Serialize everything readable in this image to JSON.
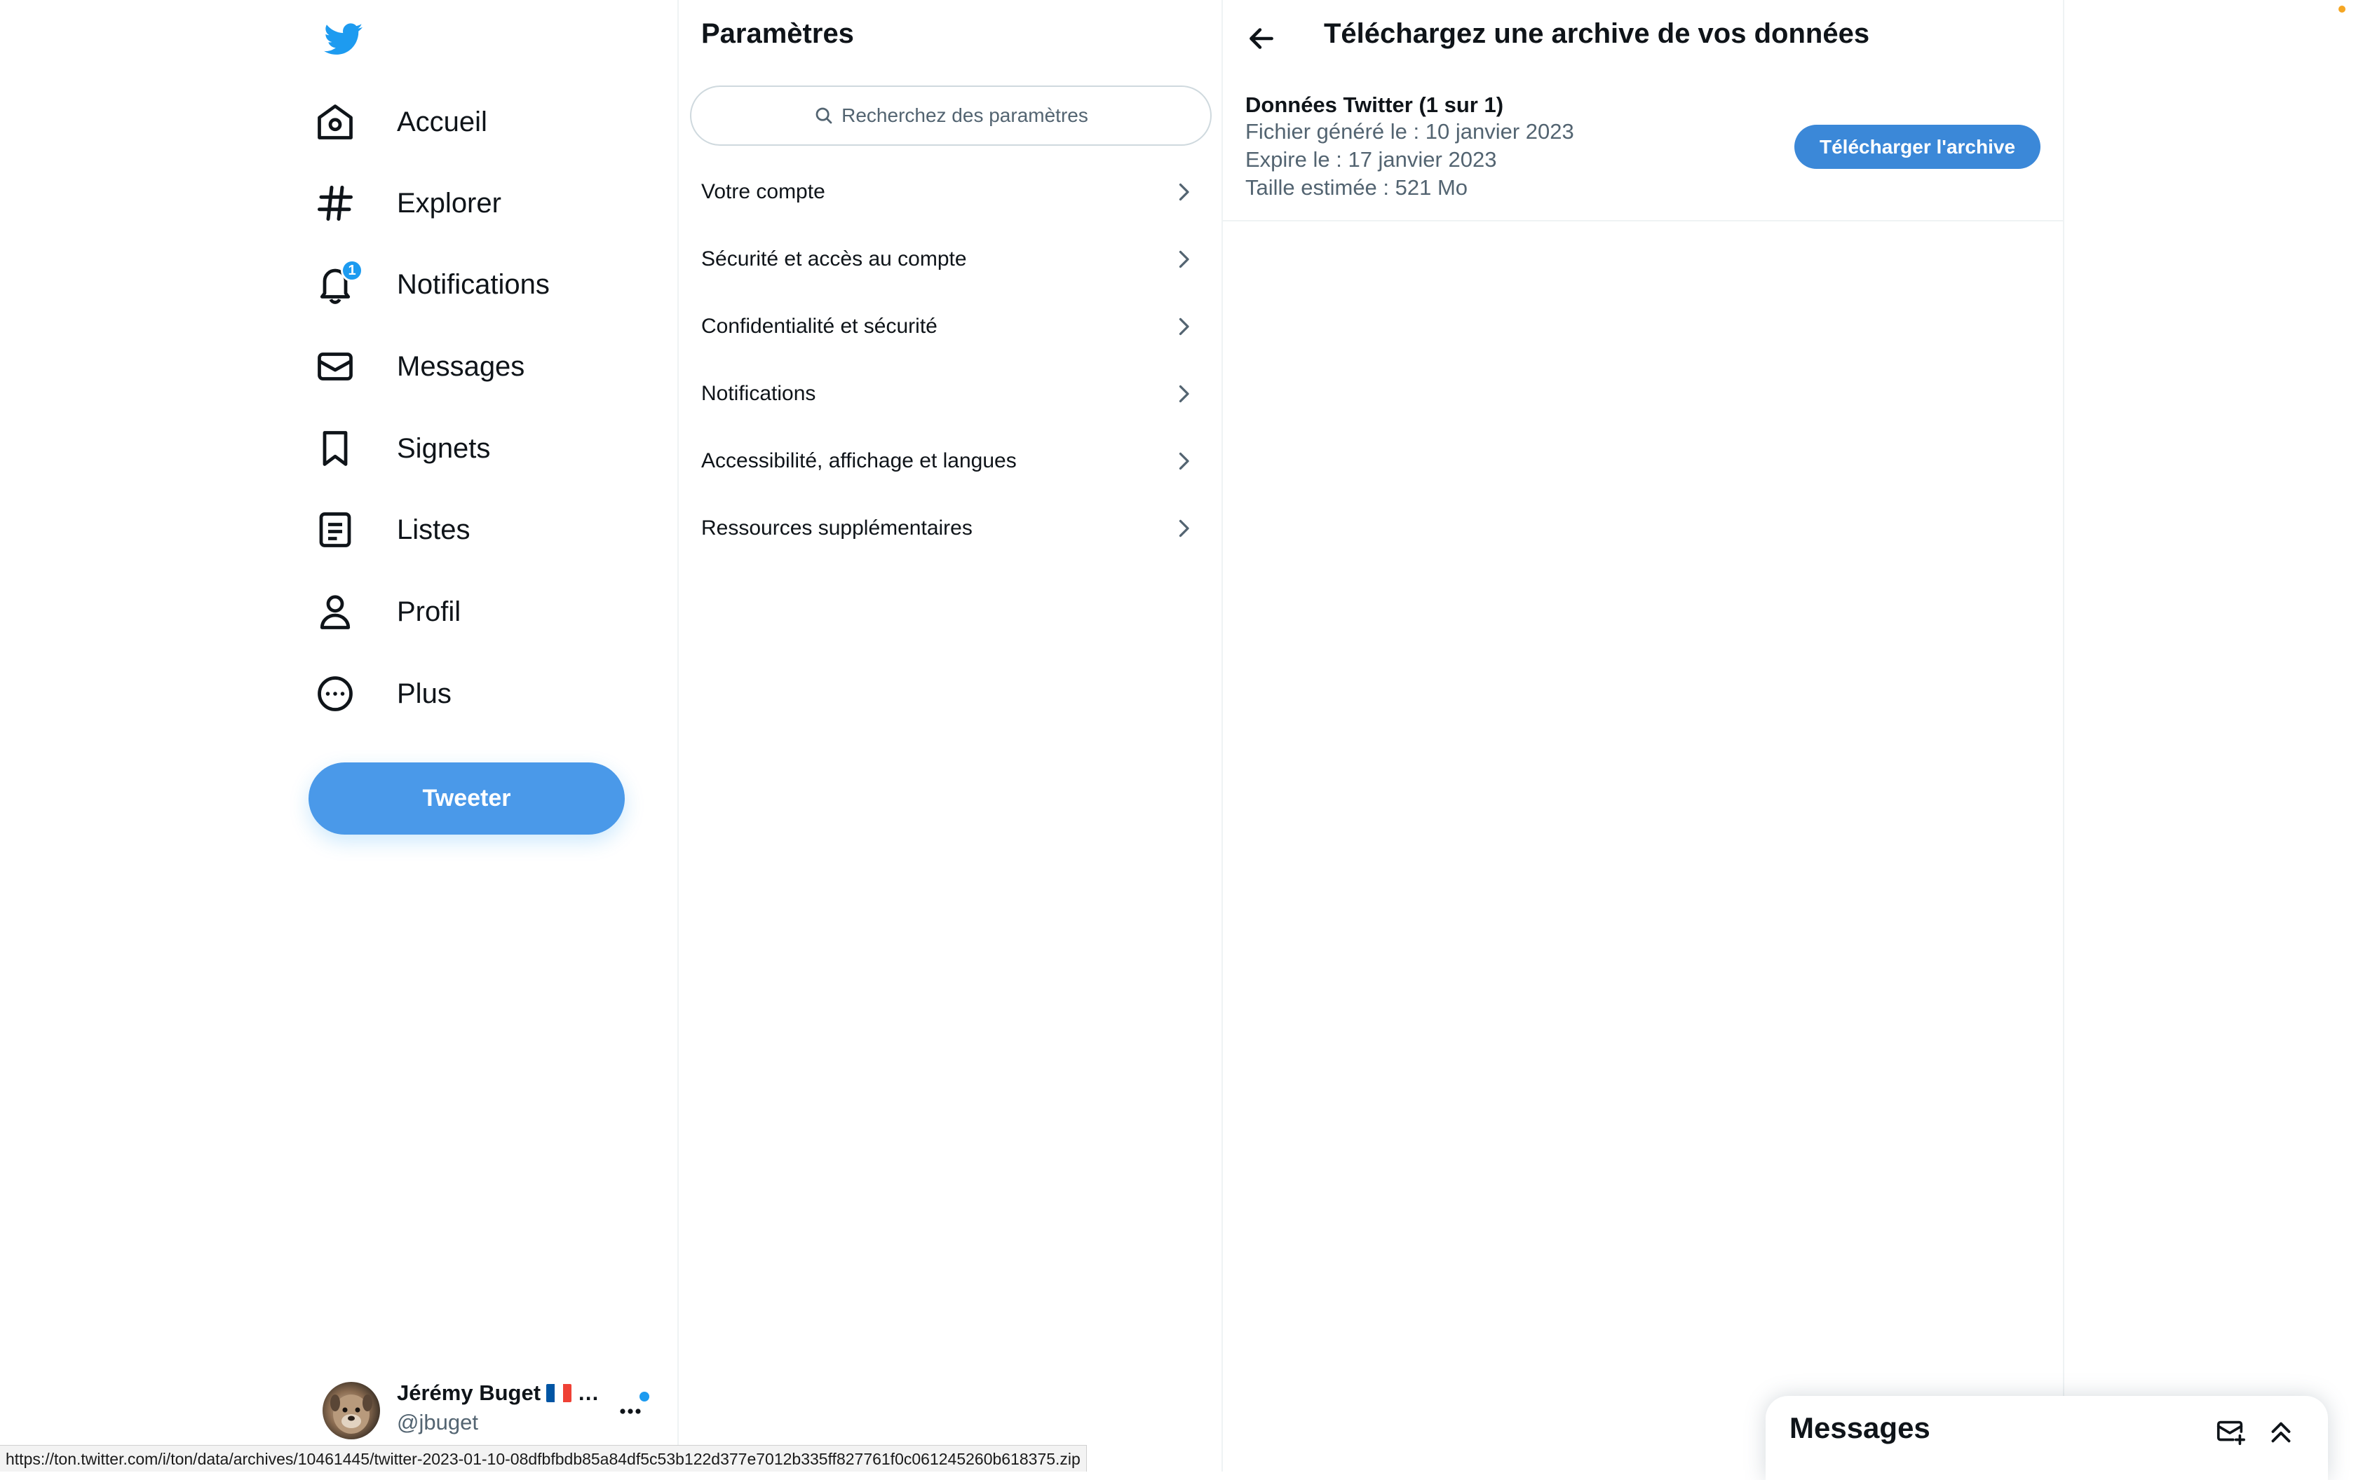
{
  "nav": {
    "logo_icon": "twitter-bird-icon",
    "items": [
      {
        "label": "Accueil",
        "icon": "home-icon"
      },
      {
        "label": "Explorer",
        "icon": "hashtag-icon"
      },
      {
        "label": "Notifications",
        "icon": "bell-icon",
        "badge": "1"
      },
      {
        "label": "Messages",
        "icon": "envelope-icon"
      },
      {
        "label": "Signets",
        "icon": "bookmark-icon"
      },
      {
        "label": "Listes",
        "icon": "list-icon"
      },
      {
        "label": "Profil",
        "icon": "person-icon"
      },
      {
        "label": "Plus",
        "icon": "more-circle-icon"
      }
    ],
    "tweet_label": "Tweeter"
  },
  "account": {
    "name": "Jérémy Buget",
    "name_suffix": "…",
    "handle": "@jbuget"
  },
  "settings": {
    "title": "Paramètres",
    "search_placeholder": "Recherchez des paramètres",
    "items": [
      {
        "label": "Votre compte"
      },
      {
        "label": "Sécurité et accès au compte"
      },
      {
        "label": "Confidentialité et sécurité"
      },
      {
        "label": "Notifications"
      },
      {
        "label": "Accessibilité, affichage et langues"
      },
      {
        "label": "Ressources supplémentaires"
      }
    ]
  },
  "archive": {
    "title": "Téléchargez une archive de vos données",
    "card": {
      "title": "Données Twitter (1 sur 1)",
      "generated": "Fichier généré le : 10 janvier 2023",
      "expires": "Expire le : 17 janvier 2023",
      "size": "Taille estimée : 521 Mo"
    },
    "download_label": "Télécharger l'archive"
  },
  "messages_drawer": {
    "title": "Messages"
  },
  "status_bar": {
    "url": "https://ton.twitter.com/i/ton/data/archives/10461445/twitter-2023-01-10-08dfbfbdb85a84df5c53b122d377e7012b335ff827761f0c061245260b618375.zip"
  },
  "colors": {
    "accent": "#1d9bf0",
    "tweet_button": "#4a99e9",
    "download_button": "#3b88d8",
    "text_primary": "#0f1419",
    "text_secondary": "#536471",
    "border": "#eff3f4"
  }
}
